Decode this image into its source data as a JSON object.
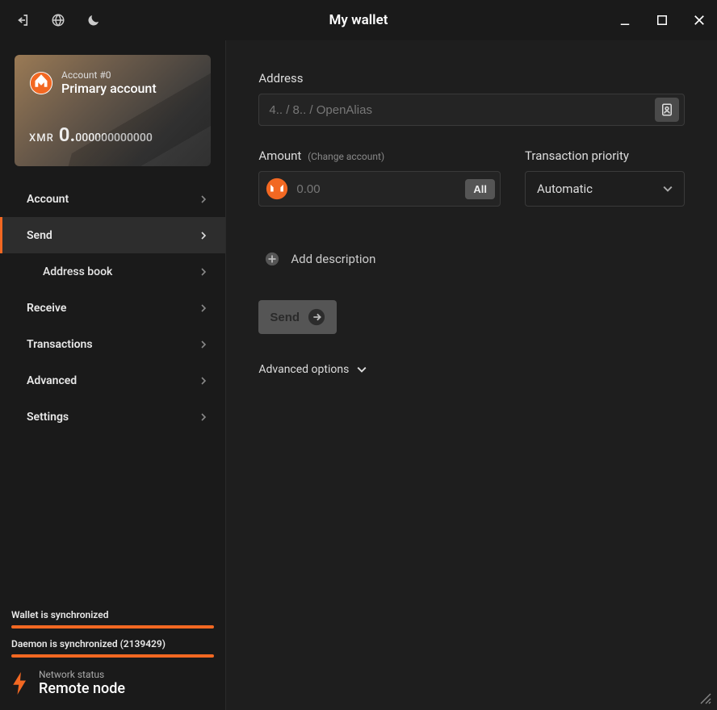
{
  "titlebar": {
    "title": "My wallet"
  },
  "account_card": {
    "account_number": "Account #0",
    "account_name": "Primary account",
    "currency": "XMR",
    "balance_int": "0.",
    "balance_frac": "000000000000"
  },
  "nav": {
    "account": "Account",
    "send": "Send",
    "address_book": "Address book",
    "receive": "Receive",
    "transactions": "Transactions",
    "advanced": "Advanced",
    "settings": "Settings"
  },
  "status": {
    "wallet_sync": "Wallet is synchronized",
    "daemon_sync": "Daemon is synchronized (2139429)",
    "network_label": "Network status",
    "network_value": "Remote node"
  },
  "form": {
    "address_label": "Address",
    "address_placeholder": "4.. / 8.. / OpenAlias",
    "amount_label": "Amount",
    "amount_sublabel": "(Change account)",
    "amount_placeholder": "0.00",
    "all_btn": "All",
    "priority_label": "Transaction priority",
    "priority_value": "Automatic",
    "add_description": "Add description",
    "send_btn": "Send",
    "advanced_options": "Advanced options"
  }
}
